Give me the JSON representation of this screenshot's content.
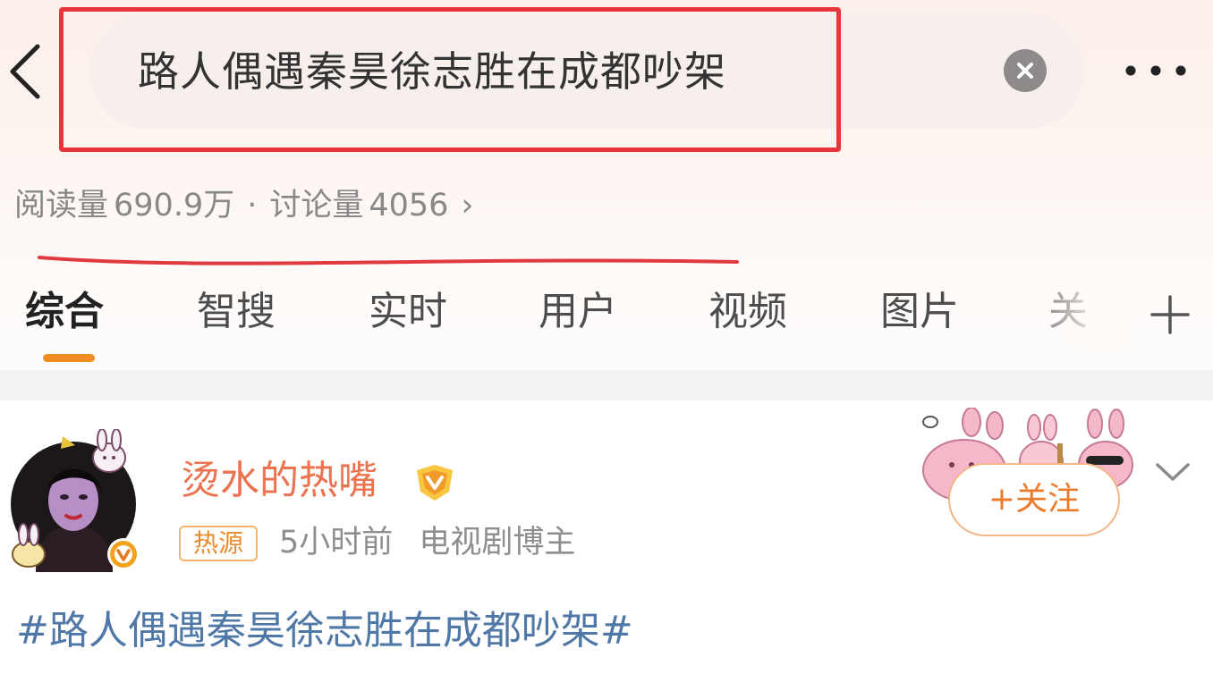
{
  "header": {
    "back_icon": "chevron-left-icon",
    "search_query": "路人偶遇秦昊徐志胜在成都吵架",
    "clear_icon": "clear-circle-icon",
    "more_icon": "more-dots-icon"
  },
  "stats": {
    "reads_label": "阅读量",
    "reads_value": "690.9万",
    "separator": "·",
    "discussions_label": "讨论量",
    "discussions_value": "4056",
    "arrow": "›"
  },
  "tabs": [
    {
      "label": "综合",
      "active": true
    },
    {
      "label": "智搜"
    },
    {
      "label": "实时"
    },
    {
      "label": "用户"
    },
    {
      "label": "视频"
    },
    {
      "label": "图片"
    },
    {
      "label": "关"
    }
  ],
  "tab_add_icon": "plus-icon",
  "post": {
    "username": "烫水的热嘴",
    "hot_tag": "热源",
    "time": "5小时前",
    "role": "电视剧博主",
    "follow_label": "+关注",
    "hashtag": "#路人偶遇秦昊徐志胜在成都吵架#"
  },
  "colors": {
    "highlight_red": "#e8353b",
    "username_orange": "#eb7350",
    "tab_indicator": "#f28d22",
    "hashtag_blue": "#5078a7"
  }
}
